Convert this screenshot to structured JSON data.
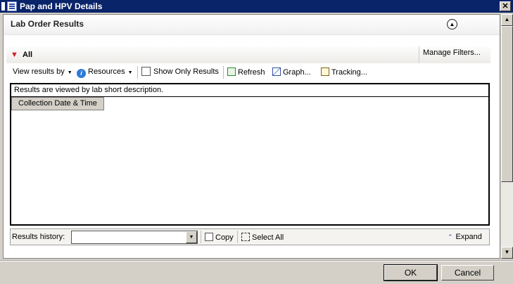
{
  "window": {
    "title": "Pap and HPV Details",
    "close_glyph": "✕"
  },
  "section": {
    "title": "Lab Order Results",
    "collapse_icon": "chevron-up-circle-icon"
  },
  "filter": {
    "label": "All",
    "manage": "Manage Filters..."
  },
  "toolbar": {
    "view_results_by": "View results by",
    "resources": "Resources",
    "show_only_results": "Show Only Results",
    "refresh": "Refresh",
    "graph": "Graph...",
    "tracking": "Tracking..."
  },
  "results": {
    "note": "Results are viewed by lab short description.",
    "column_header": "Collection Date & Time"
  },
  "history": {
    "label": "Results history:",
    "selected": "",
    "copy": "Copy",
    "select_all": "Select All",
    "expand": "Expand"
  },
  "buttons": {
    "ok": "OK",
    "cancel": "Cancel"
  },
  "colors": {
    "titlebar": "#0a246a",
    "filter_icon": "#d02020",
    "info_icon": "#2f7ad8"
  }
}
